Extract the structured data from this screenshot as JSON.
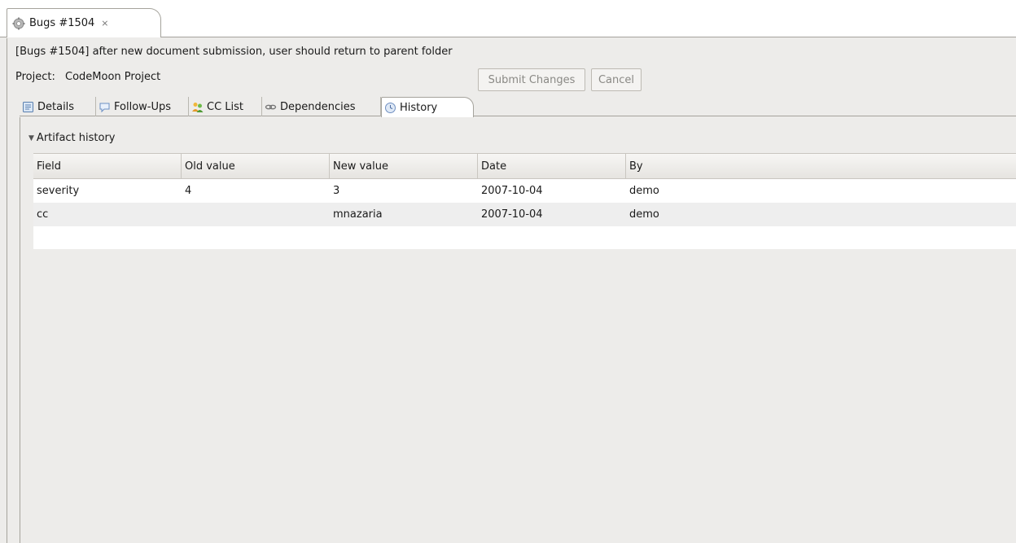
{
  "editor_tab": {
    "title": "Bugs #1504",
    "close_glyph": "⨯"
  },
  "summary": "[Bugs #1504] after new document submission, user should return to parent folder",
  "project": {
    "label": "Project:",
    "value": "CodeMoon Project"
  },
  "buttons": {
    "submit": "Submit Changes",
    "cancel": "Cancel"
  },
  "subtabs": [
    {
      "label": "Details",
      "icon": "details-icon"
    },
    {
      "label": "Follow-Ups",
      "icon": "followups-icon"
    },
    {
      "label": "CC List",
      "icon": "cclist-icon"
    },
    {
      "label": "Dependencies",
      "icon": "dependencies-icon"
    },
    {
      "label": "History",
      "icon": "history-icon",
      "active": true
    }
  ],
  "section": {
    "title": "Artifact history",
    "expanded": true
  },
  "table": {
    "columns": [
      "Field",
      "Old value",
      "New value",
      "Date",
      "By"
    ],
    "rows": [
      [
        "severity",
        "4",
        "3",
        "2007-10-04",
        "demo"
      ],
      [
        "cc",
        "",
        "mnazaria",
        "2007-10-04",
        "demo"
      ]
    ]
  }
}
